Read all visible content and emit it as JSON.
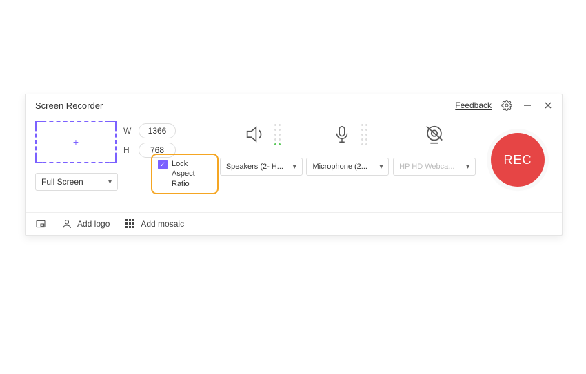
{
  "title": "Screen Recorder",
  "feedback_label": "Feedback",
  "region": {
    "width_label": "W",
    "width_value": "1366",
    "height_label": "H",
    "height_value": "768",
    "preset_label": "Full Screen"
  },
  "lock_aspect": {
    "checked": true,
    "label": "Lock Aspect Ratio"
  },
  "devices": {
    "speaker": {
      "label": "Speakers (2- H..."
    },
    "microphone": {
      "label": "Microphone (2..."
    },
    "webcam": {
      "label": "HP HD Webca...",
      "enabled": false
    }
  },
  "record_label": "REC",
  "footer": {
    "pip_tooltip": "",
    "add_logo": "Add logo",
    "add_mosaic": "Add mosaic"
  }
}
